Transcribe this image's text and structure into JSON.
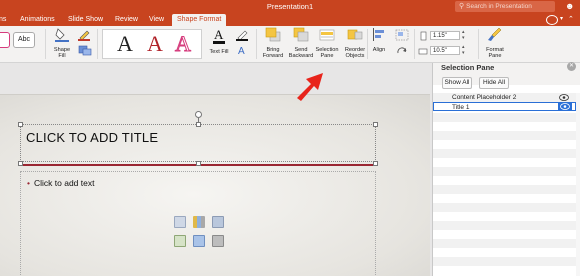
{
  "app": {
    "window_title": "Presentation1",
    "search_placeholder": "Search in Presentation"
  },
  "tabs": [
    {
      "label": "ns"
    },
    {
      "label": "Animations"
    },
    {
      "label": "Slide Show"
    },
    {
      "label": "Review"
    },
    {
      "label": "View"
    },
    {
      "label": "Shape Format",
      "active": true
    }
  ],
  "ribbon": {
    "shape_style_sample": "Abc",
    "shape_fill_label": "Shape\nFill",
    "wordart_samples": [
      "A",
      "A",
      "A"
    ],
    "text_fill_label": "Text Fill",
    "bring_forward_label": "Bring\nForward",
    "send_backward_label": "Send\nBackward",
    "selection_pane_label": "Selection\nPane",
    "reorder_objects_label": "Reorder\nObjects",
    "align_label": "Align",
    "height_value": "1.15\"",
    "width_value": "10.5\"",
    "format_pane_label": "Format\nPane"
  },
  "slide": {
    "title_placeholder": "CLICK TO ADD TITLE",
    "body_placeholder": "Click to add text"
  },
  "selection_pane": {
    "title": "Selection Pane",
    "show_all": "Show All",
    "hide_all": "Hide All",
    "items": [
      {
        "name": "Content Placeholder 2",
        "selected": false
      },
      {
        "name": "Title 1",
        "selected": true
      }
    ]
  },
  "colors": {
    "accent": "#c8441f",
    "title_rule": "#9a2632",
    "selection": "#2a6fd6",
    "annotation_arrow": "#e8241b"
  }
}
